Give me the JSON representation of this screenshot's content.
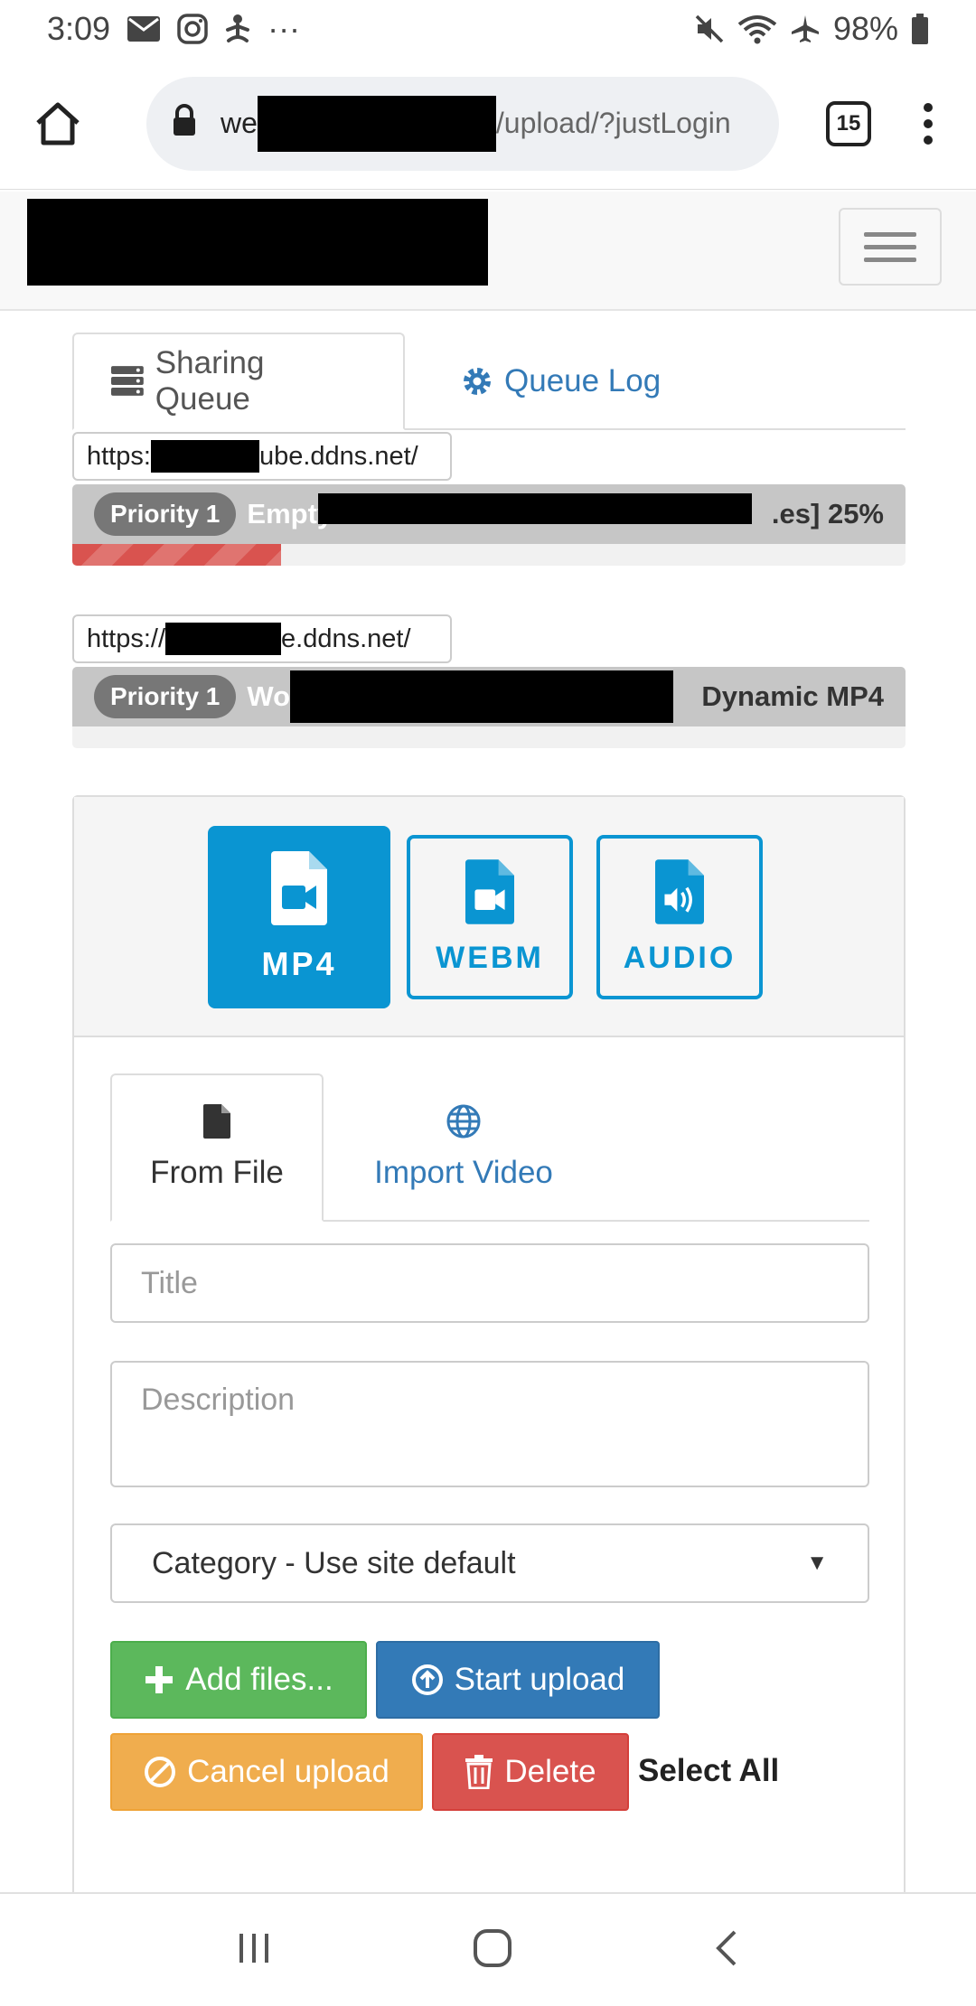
{
  "status_bar": {
    "time": "3:09",
    "battery": "98%",
    "more": "···"
  },
  "browser": {
    "url_start": "we",
    "url_end": "/upload/?justLogin",
    "tab_count": "15"
  },
  "queue_tabs": {
    "sharing_queue": "Sharing Queue",
    "queue_log": "Queue Log"
  },
  "queue_items": [
    {
      "url_start": "https:",
      "url_end": "ube.ddns.net/",
      "priority": "Priority 1",
      "title_start": "Empty",
      "title_end": ".es] 25%",
      "progress": 0.25
    },
    {
      "url_start": "https://",
      "url_end": "e.ddns.net/",
      "priority": "Priority 1",
      "title_start": "Wo",
      "title_end": "Dynamic MP4",
      "progress": 0
    }
  ],
  "formats": {
    "mp4": "MP4",
    "webm": "WEBM",
    "audio": "AUDIO"
  },
  "source_tabs": {
    "from_file": "From File",
    "import_video": "Import Video"
  },
  "form": {
    "title_placeholder": "Title",
    "description_placeholder": "Description",
    "category": "Category - Use site default"
  },
  "buttons": {
    "add_files": "Add files...",
    "start_upload": "Start upload",
    "cancel_upload": "Cancel upload",
    "delete": "Delete",
    "select_all": "Select All"
  },
  "colors": {
    "accent": "#0a95d2",
    "link": "#337ab7",
    "success": "#5cb85c",
    "warning": "#f0ad4e",
    "danger": "#d9534f"
  }
}
